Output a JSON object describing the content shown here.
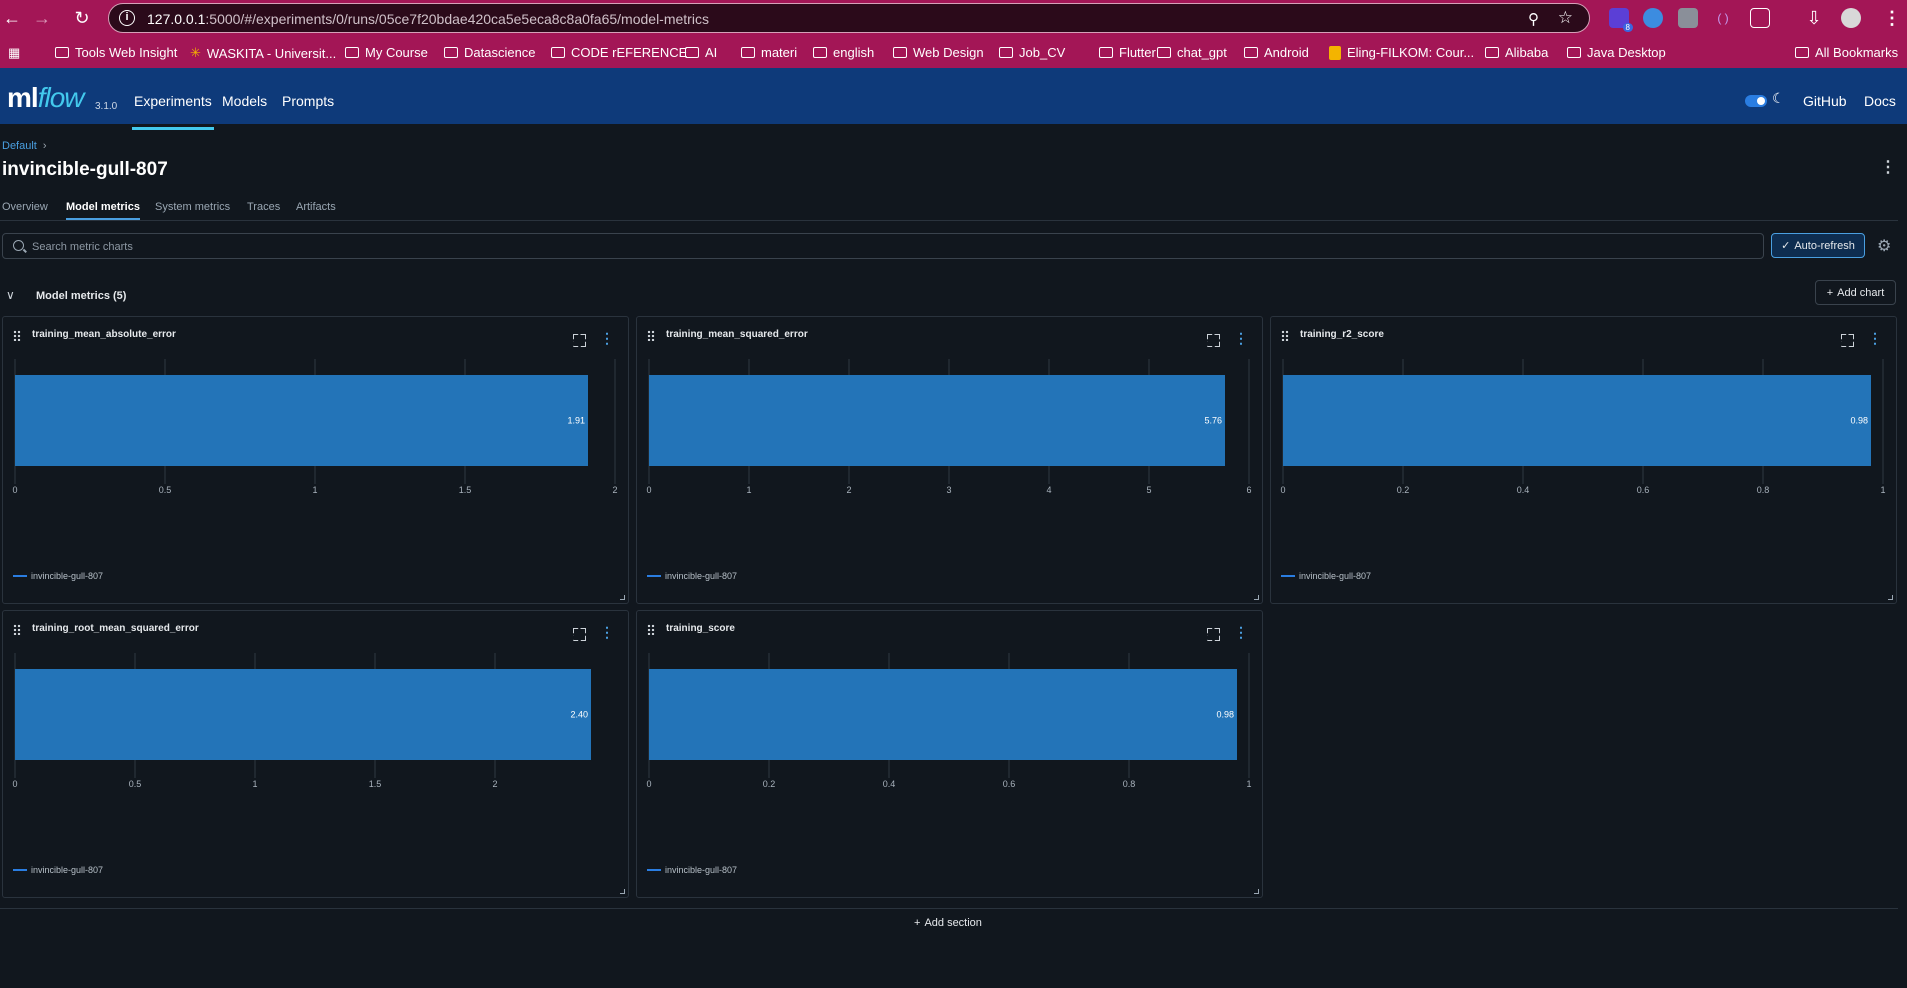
{
  "browser": {
    "url_host": "127.0.0.1",
    "url_rest": ":5000/#/experiments/0/runs/05ce7f20bdae420ca5e5eca8c8a0fa65/model-metrics",
    "extension_badge": "8",
    "bookmarks": [
      "Tools Web Insight",
      "WASKITA - Universit...",
      "My Course",
      "Datascience",
      "CODE rEFERENCE",
      "AI",
      "materi",
      "english",
      "Web Design",
      "Job_CV",
      "Flutter",
      "chat_gpt",
      "Android",
      "Eling-FILKOM: Cour...",
      "Alibaba",
      "Java Desktop"
    ],
    "all_bookmarks": "All Bookmarks"
  },
  "header": {
    "logo_ml": "ml",
    "logo_flow": "flow",
    "version": "3.1.0",
    "nav": [
      "Experiments",
      "Models",
      "Prompts"
    ],
    "links": [
      "GitHub",
      "Docs"
    ]
  },
  "run": {
    "breadcrumb": "Default",
    "title": "invincible-gull-807",
    "tabs": [
      "Overview",
      "Model metrics",
      "System metrics",
      "Traces",
      "Artifacts"
    ]
  },
  "toolbar": {
    "search_placeholder": "Search metric charts",
    "autorefresh_label": "Auto-refresh",
    "add_chart_label": "Add chart",
    "add_section_label": "Add section"
  },
  "section": {
    "title": "Model metrics (5)"
  },
  "colors": {
    "bar": "#2374b8",
    "accent": "#4a9fe0",
    "header_bg": "#0e3a7a",
    "browser_bg": "#a31656"
  },
  "chart_data": [
    {
      "type": "bar",
      "title": "training_mean_absolute_error",
      "series": [
        {
          "name": "invincible-gull-807",
          "values": [
            1.91
          ]
        }
      ],
      "value_label": "1.91",
      "xlim": [
        0,
        2
      ],
      "xticks": [
        "0",
        "0.5",
        "1",
        "1.5",
        "2"
      ],
      "tickvals": [
        0,
        0.5,
        1,
        1.5,
        2
      ]
    },
    {
      "type": "bar",
      "title": "training_mean_squared_error",
      "series": [
        {
          "name": "invincible-gull-807",
          "values": [
            5.76
          ]
        }
      ],
      "value_label": "5.76",
      "xlim": [
        0,
        6
      ],
      "xticks": [
        "0",
        "1",
        "2",
        "3",
        "4",
        "5",
        "6"
      ],
      "tickvals": [
        0,
        1,
        2,
        3,
        4,
        5,
        6
      ]
    },
    {
      "type": "bar",
      "title": "training_r2_score",
      "series": [
        {
          "name": "invincible-gull-807",
          "values": [
            0.98
          ]
        }
      ],
      "value_label": "0.98",
      "xlim": [
        0,
        1
      ],
      "xticks": [
        "0",
        "0.2",
        "0.4",
        "0.6",
        "0.8",
        "1"
      ],
      "tickvals": [
        0,
        0.2,
        0.4,
        0.6,
        0.8,
        1
      ]
    },
    {
      "type": "bar",
      "title": "training_root_mean_squared_error",
      "series": [
        {
          "name": "invincible-gull-807",
          "values": [
            2.4
          ]
        }
      ],
      "value_label": "2.40",
      "xlim": [
        0,
        2.5
      ],
      "xticks": [
        "0",
        "0.5",
        "1",
        "1.5",
        "2"
      ],
      "tickvals": [
        0,
        0.5,
        1,
        1.5,
        2
      ]
    },
    {
      "type": "bar",
      "title": "training_score",
      "series": [
        {
          "name": "invincible-gull-807",
          "values": [
            0.98
          ]
        }
      ],
      "value_label": "0.98",
      "xlim": [
        0,
        1
      ],
      "xticks": [
        "0",
        "0.2",
        "0.4",
        "0.6",
        "0.8",
        "1"
      ],
      "tickvals": [
        0,
        0.2,
        0.4,
        0.6,
        0.8,
        1
      ]
    }
  ]
}
